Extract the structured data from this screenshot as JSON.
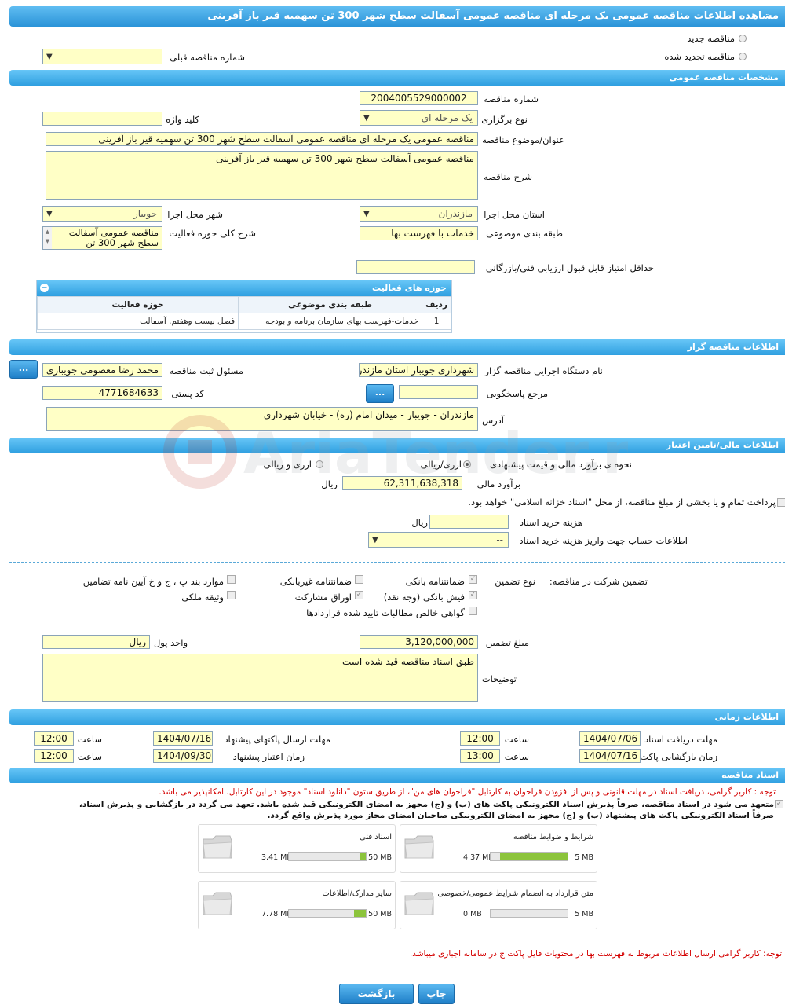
{
  "title": "مشاهده اطلاعات مناقصه عمومی یک مرحله ای مناقصه عمومی آسفالت سطح شهر 300 تن سهمیه قیر باز آفرینی",
  "top": {
    "new_tender": "مناقصه جدید",
    "renewed_tender": "مناقصه تجدید شده",
    "prev_tender_label": "شماره مناقصه قبلی",
    "prev_tender_value": "--"
  },
  "sections": {
    "general": "مشخصات مناقصه عمومی",
    "organizer": "اطلاعات مناقصه گزار",
    "finance": "اطلاعات مالی/تامین اعتبار",
    "time": "اطلاعات زمانی",
    "documents": "اسناد مناقصه"
  },
  "general": {
    "number_label": "شماره مناقصه",
    "number_value": "2004005529000002",
    "type_label": "نوع برگزاری",
    "type_value": "یک مرحله ای",
    "keyword_label": "کلید واژه",
    "keyword_value": "",
    "subject_label": "عنوان/موضوع مناقصه",
    "subject_value": "مناقصه عمومی یک مرحله ای مناقصه عمومی آسفالت سطح شهر 300 تن سهمیه قیر باز آفرینی",
    "desc_label": "شرح مناقصه",
    "desc_value": "مناقصه عمومی آسفالت سطح شهر 300 تن سهمیه قیر باز آفرینی",
    "province_label": "استان محل اجرا",
    "province_value": "مازندران",
    "city_label": "شهر محل اجرا",
    "city_value": "جویبار",
    "category_label": "طبقه بندی موضوعی",
    "category_value": "خدمات با فهرست بها",
    "scope_label": "شرح کلی حوزه فعالیت",
    "scope_value": "مناقصه عمومی آسفالت سطح شهر 300 تن",
    "min_score_label": "حداقل امتیاز قابل قبول ارزیابی فنی/بازرگانی",
    "min_score_value": ""
  },
  "activity": {
    "title": "حوزه های فعالیت",
    "col_row": "ردیف",
    "col_category": "طبقه بندی موضوعی",
    "col_scope": "حوزه فعالیت",
    "rows": [
      {
        "n": "1",
        "category": "خدمات-فهرست بهای سازمان برنامه و بودجه",
        "scope": "فصل بیست وهفتم. آسفالت"
      }
    ]
  },
  "organizer": {
    "org_label": "نام دستگاه اجرایی مناقصه گزار",
    "org_value": "شهرداری جویبار استان مازندران",
    "officer_label": "مسئول ثبت مناقصه",
    "officer_value": "محمد رضا  معصومی جویباری",
    "ref_label": "مرجع پاسخگویی",
    "ref_value": "",
    "postal_label": "کد پستی",
    "postal_value": "4771684633",
    "address_label": "آدرس",
    "address_value": "مازندران - جویبار - میدان امام (ره) - خیابان شهرداری",
    "more_btn": "..."
  },
  "finance": {
    "method_label": "نحوه ی برآورد مالی و قیمت پیشنهادی",
    "opt_rial": "ارزی/ریالی",
    "opt_both": "ارزی و ریالی",
    "estimate_label": "برآورد مالی",
    "estimate_value": "62,311,638,318",
    "estimate_unit": "ریال",
    "treasury_text": "پرداخت تمام و یا بخشی از مبلغ مناقصه، از محل \"اسناد خزانه اسلامی\" خواهد بود.",
    "doc_cost_label": "هزینه خرید اسناد",
    "doc_cost_value": "",
    "doc_cost_unit": "ریال",
    "account_label": "اطلاعات حساب جهت واریز هزینه خرید اسناد",
    "account_value": "--"
  },
  "guarantee": {
    "label": "تضمین شرکت در مناقصه:",
    "type_label": "نوع تضمین",
    "opt_bank": "ضمانتنامه بانکی",
    "opt_nonbank": "ضمانتنامه غیربانکی",
    "opt_items": "موارد بند پ ، ج و خ آیین نامه تضامین",
    "opt_cash": "فیش بانکی (وجه نقد)",
    "opt_bonds": "اوراق مشارکت",
    "opt_property": "وثیقه ملکی",
    "opt_claims": "گواهی خالص مطالبات تایید شده قراردادها",
    "amount_label": "مبلغ تضمین",
    "amount_value": "3,120,000,000",
    "currency_label": "واحد پول",
    "currency_value": "ریال",
    "notes_label": "توضیحات",
    "notes_value": "طبق اسناد مناقصه قید شده است"
  },
  "time": {
    "receive_label": "مهلت دریافت اسناد",
    "receive_date": "1404/07/06",
    "receive_time": "12:00",
    "send_label": "مهلت ارسال پاکتهای پیشنهاد",
    "send_date": "1404/07/16",
    "send_time": "12:00",
    "open_label": "زمان بازگشایی پاکت ها",
    "open_date": "1404/07/16",
    "open_time": "13:00",
    "valid_label": "زمان اعتبار پیشنهاد",
    "valid_date": "1404/09/30",
    "valid_time": "12:00",
    "time_word": "ساعت"
  },
  "documents": {
    "note1": "توجه : کاربر گرامی، دریافت اسناد در مهلت قانونی و پس از افزودن فراخوان به کارتابل \"فراخوان های من\"، از طریق ستون \"دانلود اسناد\" موجود در این کارتابل، امکانپذیر می باشد.",
    "commit_line1": "متعهد می شود در اسناد مناقصه، صرفاً پذیرش اسناد الکترونیکی پاکت های (ب) و (ج) مجهز به امضای الکترونیکی قید شده باشد. تعهد می گردد در بازگشایی و پذیرش اسناد،",
    "commit_line2": "صرفاً اسناد الکترونیکی پاکت های پیشنهاد (ب) و (ج) مجهز به امضای الکترونیکی صاحبان امضای مجاز مورد پذیرش واقع گردد.",
    "cards": [
      {
        "title": "شرایط و ضوابط مناقصه",
        "size": "4.37 MB",
        "max": "5 MB",
        "fill": 0.874
      },
      {
        "title": "اسناد فنی",
        "size": "3.41 MB",
        "max": "50 MB",
        "fill": 0.068
      },
      {
        "title": "متن قرارداد به انضمام شرایط عمومی/خصوصی",
        "size": "0 MB",
        "max": "5 MB",
        "fill": 0
      },
      {
        "title": "سایر مدارک/اطلاعات",
        "size": "7.78 MB",
        "max": "50 MB",
        "fill": 0.156
      }
    ],
    "note2": "توجه: کاربر گرامی ارسال اطلاعات مربوط به فهرست بها در محتویات فایل پاکت ج در سامانه اجباری میباشد."
  },
  "buttons": {
    "print": "چاپ",
    "back": "بازگشت"
  },
  "watermark": "AriaTender.neT"
}
